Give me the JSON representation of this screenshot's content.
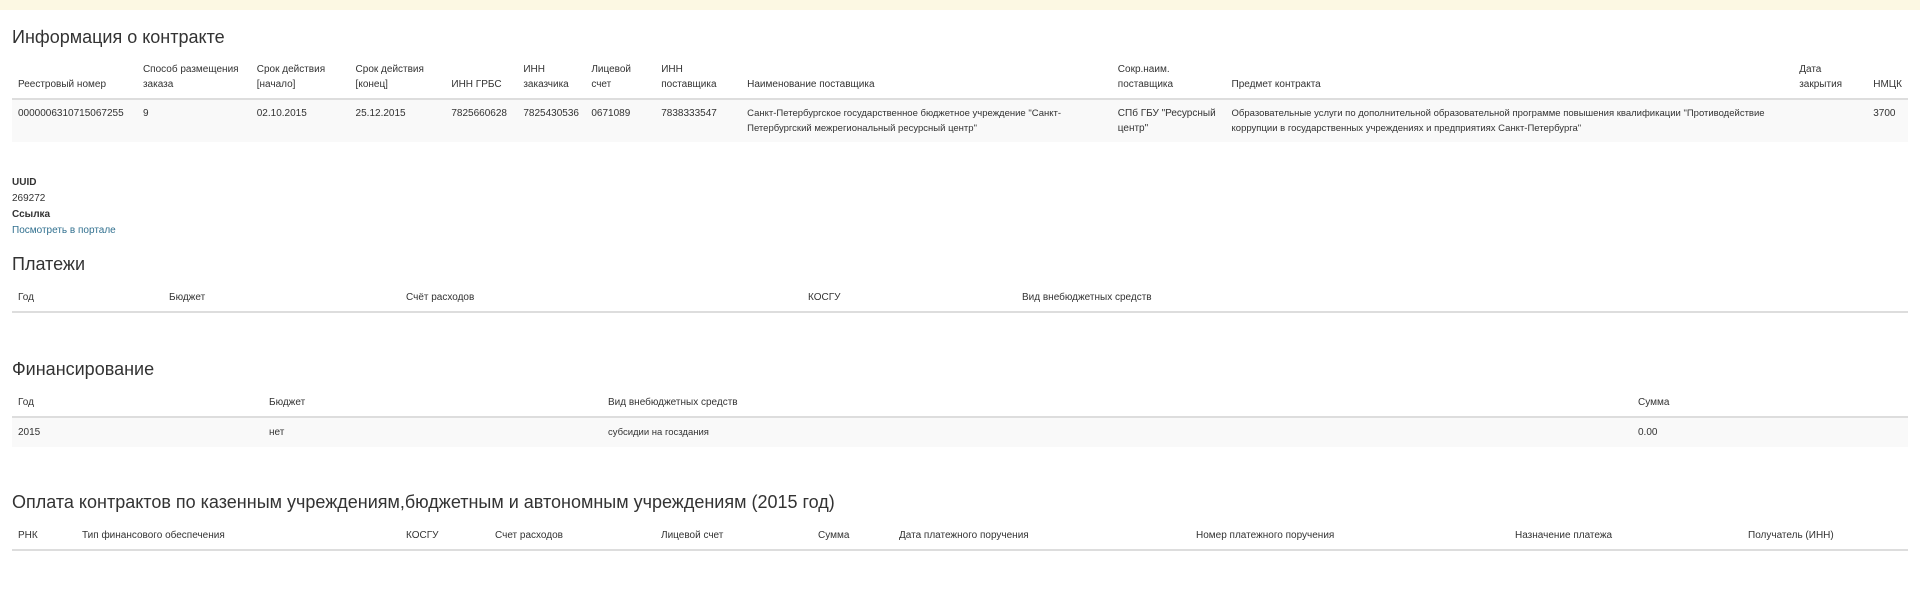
{
  "contract": {
    "title": "Информация о контракте",
    "headers": [
      "Реестровый номер",
      "Способ размещения заказа",
      "Срок действия [начало]",
      "Срок действия [конец]",
      "ИНН ГРБС",
      "ИНН заказчика",
      "Лицевой счет",
      "ИНН поставщика",
      "Наименование поставщика",
      "Сокр.наим. поставщика",
      "Предмет контракта",
      "Дата закрытия",
      "НМЦК"
    ],
    "row": [
      "0000006310715067255",
      "9",
      "02.10.2015",
      "25.12.2015",
      "7825660628",
      "7825430536",
      "0671089",
      "7838333547",
      "Санкт-Петербургское государственное бюджетное учреждение \"Санкт-Петербургский межрегиональный ресурсный центр\"",
      "СПб ГБУ \"Ресурсный центр\"",
      "Образовательные услуги по дополнительной образовательной программе повышения квалификации \"Противодействие коррупции в государственных учреждениях и предприятиях Санкт-Петербурга\"",
      "",
      "3700"
    ]
  },
  "info": {
    "uuid_label": "UUID",
    "uuid_value": "269272",
    "link_label": "Ссылка",
    "link_text": "Посмотреть в портале"
  },
  "payments": {
    "title": "Платежи",
    "headers": [
      "Год",
      "Бюджет",
      "Счёт расходов",
      "КОСГУ",
      "Вид внебюджетных средств"
    ]
  },
  "financing": {
    "title": "Финансирование",
    "headers": [
      "Год",
      "Бюджет",
      "Вид внебюджетных средств",
      "Сумма"
    ],
    "row": [
      "2015",
      "нет",
      "субсидии на госздания",
      "0.00"
    ]
  },
  "contract_payments": {
    "title": "Оплата контрактов по казенным учреждениям,бюджетным и автономным учреждениям (2015 год)",
    "headers": [
      "РНК",
      "Тип финансового обеспечения",
      "КОСГУ",
      "Счет расходов",
      "Лицевой счет",
      "Сумма",
      "Дата платежного поручения",
      "Номер платежного поручения",
      "Назначение платежа",
      "Получатель (ИНН)"
    ]
  }
}
